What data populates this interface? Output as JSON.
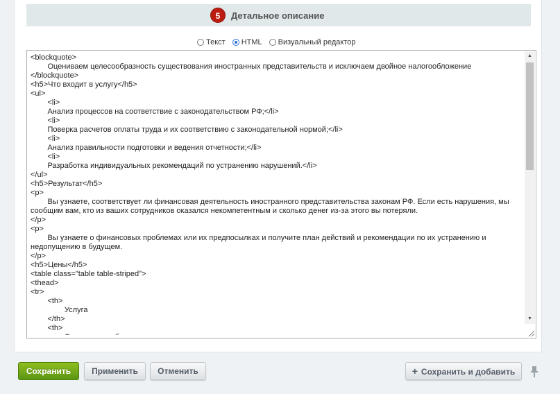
{
  "section": {
    "step_number": "5",
    "title": "Детальное описание"
  },
  "mode_switch": {
    "options": [
      "Текст",
      "HTML",
      "Визуальный редактор"
    ],
    "selected": "HTML"
  },
  "editor": {
    "content": "<blockquote>\n        Оцениваем целесообразность существования иностранных представительств и исключаем двойное налогообложение\n</blockquote>\n<h5>Что входит в услугу</h5>\n<ul>\n        <li>\n        Анализ процессов на соответствие с законодательством РФ;</li>\n        <li>\n        Поверка расчетов оплаты труда и их соответствию с законодательной нормой;</li>\n        <li>\n        Анализ правильности подготовки и ведения отчетности;</li>\n        <li>\n        Разработка индивидуальных рекомендаций по устранению нарушений.</li>\n</ul>\n<h5>Результат</h5>\n<p>\n        Вы узнаете, соответствует ли финансовая деятельность иностранного представительства законам РФ. Если есть нарушения, мы сообщим вам, кто из ваших сотрудников оказался некомпетентным и сколько денег из-за этого вы потеряли.\n</p>\n<p>\n        Вы узнаете о финансовых проблемах или их предпосылках и получите план действий и рекомендации по их устранению и недопущению в будущем.\n</p>\n<h5>Цены</h5>\n<table class=\"table table-striped\">\n<thead>\n<tr>\n        <th>\n                Услуга\n        </th>\n        <th>\n                Стоимость, руб.",
    "scroll_position": 0.0
  },
  "footer": {
    "save_label": "Сохранить",
    "apply_label": "Применить",
    "cancel_label": "Отменить",
    "save_add_label": "Сохранить и добавить",
    "icons": {
      "save_add": "plus-icon",
      "pin": "pin-icon"
    }
  },
  "colors": {
    "accent_green": "#6aa616",
    "badge_red": "#bc1d10",
    "header_bg": "#e0e8ea",
    "radio_selected": "#2c6ed5"
  }
}
